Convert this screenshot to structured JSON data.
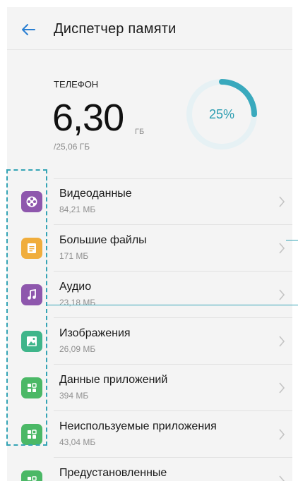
{
  "header": {
    "title": "Диспетчер памяти"
  },
  "storage": {
    "label": "ТЕЛЕФОН",
    "used_value": "6,30",
    "used_unit": "ГБ",
    "total": "/25,06 ГБ",
    "percent_text": "25%",
    "percent_fraction": 0.25,
    "ring_color": "#39a9bd",
    "ring_track_color": "#e6f1f4"
  },
  "items": [
    {
      "label": "Видеоданные",
      "size": "84,21 МБ",
      "icon": "video-reel-icon",
      "color": "#8e57ad"
    },
    {
      "label": "Большие файлы",
      "size": "171 МБ",
      "icon": "document-icon",
      "color": "#f0ad3c"
    },
    {
      "label": "Аудио",
      "size": "23,18 МБ",
      "icon": "music-note-icon",
      "color": "#8e57ad"
    },
    {
      "label": "Изображения",
      "size": "26,09 МБ",
      "icon": "image-icon",
      "color": "#3fb58a"
    },
    {
      "label": "Данные приложений",
      "size": "394 МБ",
      "icon": "apps-grid-icon",
      "color": "#4bb866"
    },
    {
      "label": "Неиспользуемые приложения",
      "size": "43,04 МБ",
      "icon": "apps-grid-icon",
      "color": "#4bb866"
    },
    {
      "label": "Предустановленные",
      "size": "",
      "icon": "apps-grid-icon",
      "color": "#4bb866"
    }
  ],
  "colors": {
    "accent": "#39a9bd",
    "background": "#f4f4f4"
  }
}
